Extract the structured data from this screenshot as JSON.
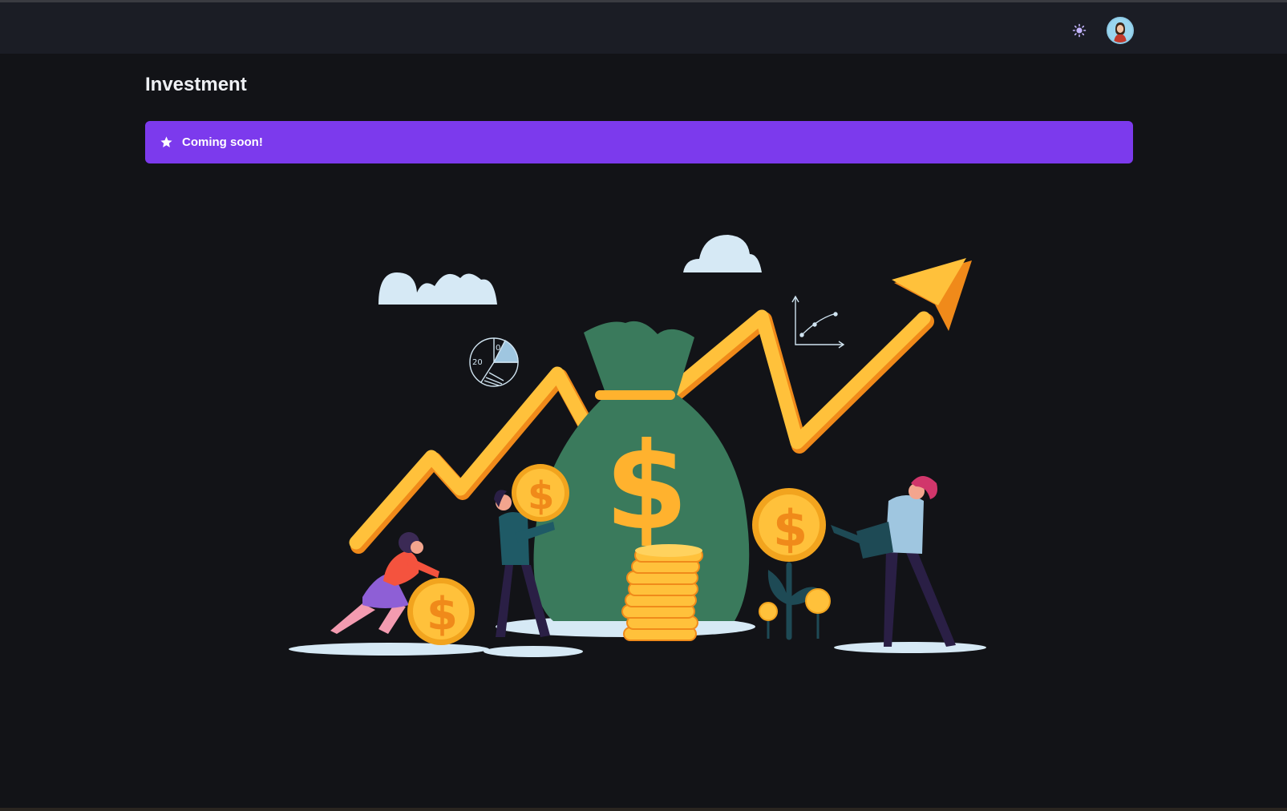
{
  "header": {
    "theme_toggle_icon": "sun-icon",
    "avatar_icon": "user-avatar"
  },
  "page": {
    "title": "Investment"
  },
  "banner": {
    "icon": "star-icon",
    "text": "Coming soon!",
    "color": "#7c3aed"
  },
  "illustration": {
    "pie_labels": [
      "20",
      "0"
    ]
  },
  "colors": {
    "background": "#121317",
    "topbar": "#1b1d25",
    "accent": "#7c3aed",
    "bag": "#3a7a5c",
    "gold": "#ffc13b",
    "arrow": "#ffb22e"
  }
}
